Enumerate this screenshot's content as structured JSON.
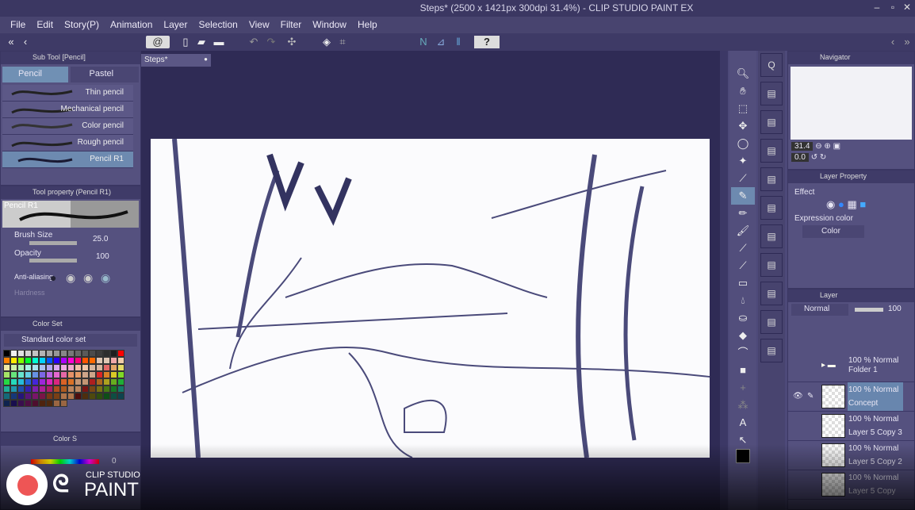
{
  "window": {
    "title": "Steps* (2500 x 1421px 300dpi 31.4%) - CLIP STUDIO PAINT EX"
  },
  "menu": [
    "File",
    "Edit",
    "Story(P)",
    "Animation",
    "Layer",
    "Selection",
    "View",
    "Filter",
    "Window",
    "Help"
  ],
  "document_tab": "Steps*",
  "subtool": {
    "header": "Sub Tool [Pencil]",
    "tabs": [
      "Pencil",
      "Pastel"
    ],
    "brushes": [
      "Thin pencil",
      "Mechanical pencil",
      "Color pencil",
      "Rough pencil",
      "Pencil R1"
    ],
    "selected": "Pencil R1"
  },
  "toolprop": {
    "header": "Tool property (Pencil R1)",
    "preview_name": "Pencil R1",
    "brush_size_label": "Brush Size",
    "brush_size": "25.0",
    "opacity_label": "Opacity",
    "opacity": "100",
    "antialias_label": "Anti-aliasing",
    "hardness_label": "Hardness"
  },
  "colorset": {
    "header": "Color Set",
    "set_name": "Standard color set"
  },
  "color_slider": {
    "tab": "Color S",
    "value": "0"
  },
  "logo": {
    "line1": "CLIP STUDIO",
    "line2": "PAINT"
  },
  "navigator": {
    "header": "Navigator",
    "zoom": "31.4",
    "rotation": "0.0"
  },
  "layer_property": {
    "header": "Layer Property",
    "effect_label": "Effect",
    "expression_label": "Expression color",
    "expression_value": "Color"
  },
  "layer_panel": {
    "header": "Layer",
    "blend": "Normal",
    "opacity": "100",
    "layers": [
      {
        "mode": "100 % Normal",
        "name": "Folder 1"
      },
      {
        "mode": "100 % Normal",
        "name": "Concept"
      },
      {
        "mode": "100 % Normal",
        "name": "Layer 5 Copy 3"
      },
      {
        "mode": "100 % Normal",
        "name": "Layer 5 Copy 2"
      },
      {
        "mode": "100 % Normal",
        "name": "Layer 5 Copy"
      }
    ]
  }
}
